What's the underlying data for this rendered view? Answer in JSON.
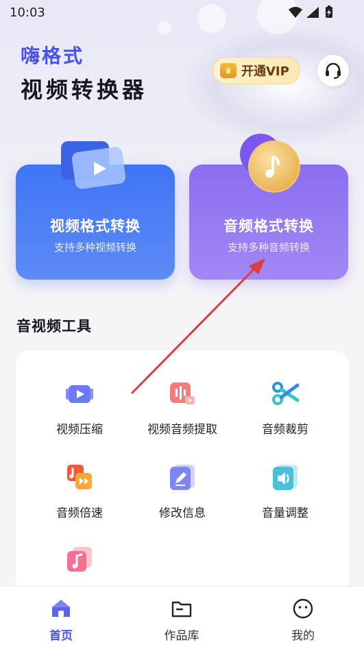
{
  "status_bar": {
    "time": "10:03"
  },
  "brand": {
    "line1": "嗨格式",
    "line2": "视频转换器"
  },
  "header": {
    "vip_label": "开通VIP",
    "crown_icon": "crown-icon",
    "support_icon": "headset-icon"
  },
  "feature_cards": [
    {
      "title": "视频格式转换",
      "subtitle": "支持多种视频转换",
      "icon": "video-play-icon",
      "color": "#3f74f4"
    },
    {
      "title": "音频格式转换",
      "subtitle": "支持多种音频转换",
      "icon": "music-note-icon",
      "color": "#8b6ef0"
    }
  ],
  "tools_section": {
    "title": "音视频工具",
    "items": [
      {
        "label": "视频压缩",
        "icon": "video-compress-icon"
      },
      {
        "label": "视频音频提取",
        "icon": "audio-extract-icon"
      },
      {
        "label": "音频裁剪",
        "icon": "scissors-icon"
      },
      {
        "label": "音频倍速",
        "icon": "audio-speed-icon"
      },
      {
        "label": "修改信息",
        "icon": "edit-info-icon"
      },
      {
        "label": "音量调整",
        "icon": "volume-icon"
      },
      {
        "label": "",
        "icon": "music-file-icon"
      }
    ]
  },
  "tab_bar": {
    "items": [
      {
        "label": "首页",
        "icon": "home-icon",
        "active": true
      },
      {
        "label": "作品库",
        "icon": "folder-icon",
        "active": false
      },
      {
        "label": "我的",
        "icon": "profile-icon",
        "active": false
      }
    ]
  },
  "colors": {
    "accent": "#4650f0",
    "annotation_arrow": "#e03a3a"
  }
}
